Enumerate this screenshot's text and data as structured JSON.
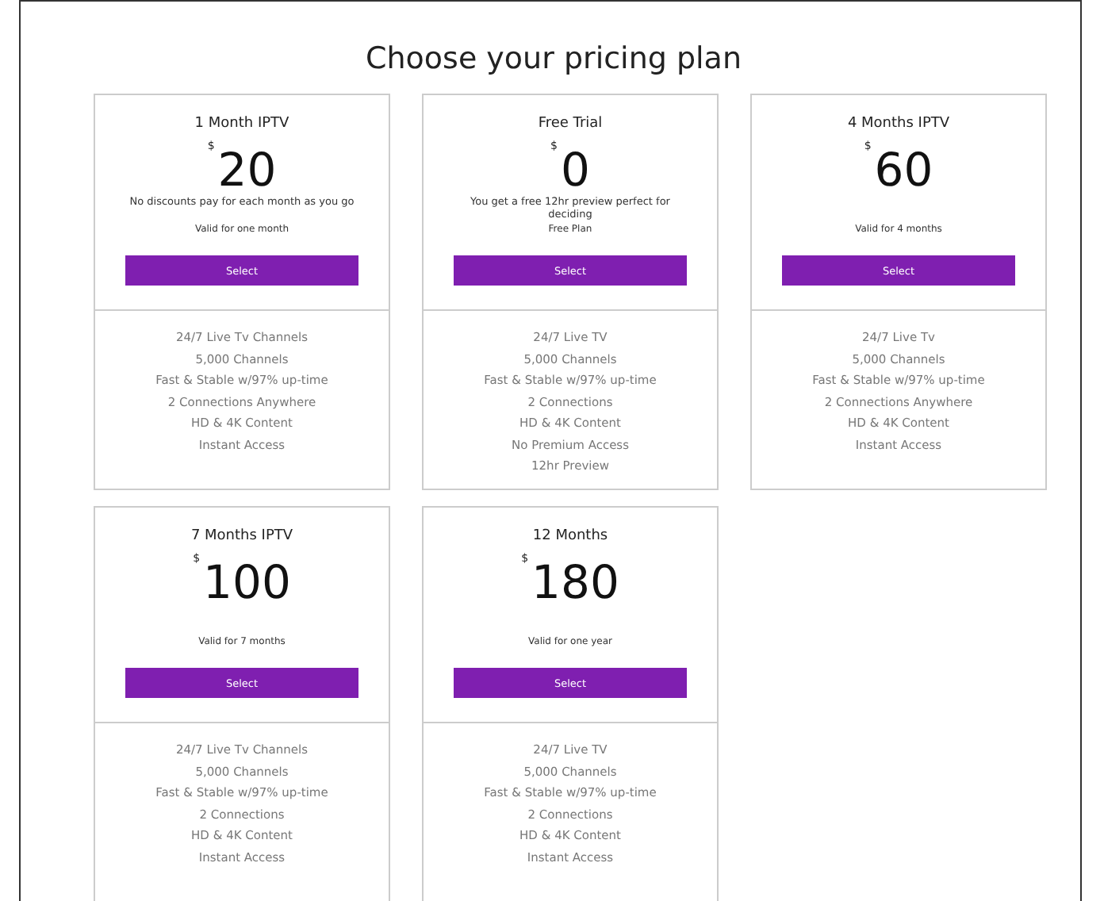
{
  "title": "Choose your pricing plan",
  "plans": [
    {
      "name": "1 Month IPTV",
      "currency": "$",
      "price": "20",
      "description": "No discounts pay for each month as you go",
      "validity": "Valid for one month",
      "button": "Select",
      "features": [
        "24/7 Live Tv Channels",
        "5,000 Channels",
        "Fast & Stable w/97% up-time",
        "2 Connections Anywhere",
        "HD & 4K Content",
        "Instant Access"
      ]
    },
    {
      "name": "Free Trial",
      "currency": "$",
      "price": "0",
      "description": "You get a free 12hr preview perfect for deciding",
      "validity": "Free Plan",
      "button": "Select",
      "features": [
        "24/7 Live TV",
        "5,000 Channels",
        "Fast & Stable w/97% up-time",
        "2 Connections",
        "HD & 4K Content",
        "No Premium Access",
        "12hr Preview"
      ]
    },
    {
      "name": "4 Months IPTV",
      "currency": "$",
      "price": "60",
      "validity": "Valid for 4 months",
      "button": "Select",
      "features": [
        "24/7 Live Tv",
        "5,000 Channels",
        "Fast & Stable w/97% up-time",
        "2 Connections Anywhere",
        "HD & 4K Content",
        "Instant Access"
      ]
    },
    {
      "name": "7 Months IPTV",
      "currency": "$",
      "price": "100",
      "validity": "Valid for 7 months",
      "button": "Select",
      "features": [
        "24/7 Live Tv Channels",
        "5,000 Channels",
        "Fast & Stable w/97% up-time",
        "2 Connections",
        "HD & 4K Content",
        "Instant Access"
      ]
    },
    {
      "name": "12 Months",
      "currency": "$",
      "price": "180",
      "validity": "Valid for one year",
      "button": "Select",
      "features": [
        "24/7 Live TV",
        "5,000 Channels",
        "Fast & Stable w/97% up-time",
        "2 Connections",
        "HD & 4K Content",
        "Instant Access"
      ]
    }
  ]
}
